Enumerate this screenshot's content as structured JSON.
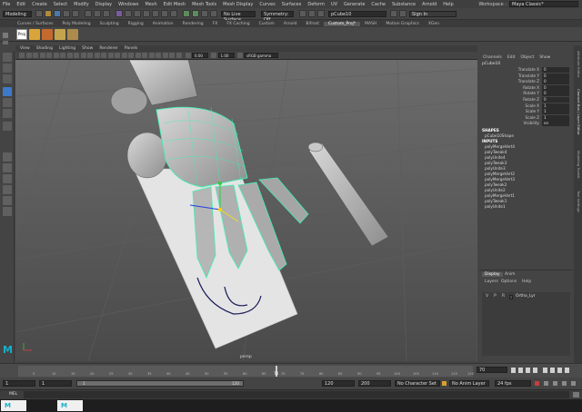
{
  "menubar": {
    "items": [
      "File",
      "Edit",
      "Create",
      "Select",
      "Modify",
      "Display",
      "Windows",
      "Mesh",
      "Edit Mesh",
      "Mesh Tools",
      "Mesh Display",
      "Curves",
      "Surfaces",
      "Deform",
      "UV",
      "Generate",
      "Cache",
      "Substance",
      "Arnold",
      "Help"
    ],
    "workspace_label": "Workspace :",
    "workspace_value": "Maya Classic*"
  },
  "statusline": {
    "mode": "Modeling",
    "live_surface": "No Live Surface",
    "symmetry": "Symmetry: Off",
    "object_name": "pCube10",
    "sign_in": "Sign In"
  },
  "shelf": {
    "tabs": [
      "Curves / Surfaces",
      "Poly Modeling",
      "Sculpting",
      "Rigging",
      "Animation",
      "Rendering",
      "FX",
      "FX Caching",
      "Custom",
      "Arnold",
      "Bifrost",
      "Custom_Proj*",
      "MASH",
      "Motion Graphics",
      "XGen"
    ],
    "active_tab": "Custom_Proj*",
    "label": "Proj"
  },
  "viewport": {
    "menus": [
      "View",
      "Shading",
      "Lighting",
      "Show",
      "Renderer",
      "Panels"
    ],
    "field1": "0.00",
    "field2": "1.00",
    "color_space": "sRGB gamma",
    "camera_label": "persp"
  },
  "channelbox": {
    "menus": [
      "Channels",
      "Edit",
      "Object",
      "Show"
    ],
    "object": "pCube10",
    "attributes": [
      {
        "name": "Translate X",
        "value": "0"
      },
      {
        "name": "Translate Y",
        "value": "0"
      },
      {
        "name": "Translate Z",
        "value": "0"
      },
      {
        "name": "Rotate X",
        "value": "0"
      },
      {
        "name": "Rotate Y",
        "value": "0"
      },
      {
        "name": "Rotate Z",
        "value": "0"
      },
      {
        "name": "Scale X",
        "value": "1"
      },
      {
        "name": "Scale Y",
        "value": "1"
      },
      {
        "name": "Scale Z",
        "value": "1"
      },
      {
        "name": "Visibility",
        "value": "on"
      }
    ],
    "shapes_header": "SHAPES",
    "shape": "pCube10Shape",
    "inputs_header": "INPUTS",
    "inputs": [
      "polyMergeVert4",
      "polyTweak4",
      "polyUnite4",
      "polyTweak3",
      "polyUnite3",
      "polyMergeVert2",
      "polyMergeVert3",
      "polyTweak2",
      "polyUnite2",
      "polyMergeVert1",
      "polyTweak1",
      "polyUnite1"
    ]
  },
  "layer_editor": {
    "tabs": [
      "Display",
      "Anim"
    ],
    "menus": [
      "Layers",
      "Options",
      "Help"
    ],
    "layer_flags": [
      "V",
      "P",
      "R"
    ],
    "layer_name": "Ortho_Lyr"
  },
  "right_tabs": [
    "Attribute Editor",
    "Channel Box / Layer Editor",
    "Modeling Toolkit",
    "Tool Settings"
  ],
  "timeline": {
    "ticks": [
      "5",
      "10",
      "15",
      "20",
      "25",
      "30",
      "35",
      "40",
      "45",
      "50",
      "55",
      "60",
      "65",
      "70",
      "75",
      "80",
      "85",
      "90",
      "95",
      "100",
      "105",
      "110",
      "115",
      "120"
    ],
    "current_frame": "70",
    "end_field": "70"
  },
  "range": {
    "start": "1",
    "start_inner": "1",
    "range_left": "1",
    "range_right": "120",
    "end_inner": "120",
    "end": "200",
    "character_set": "No Character Set",
    "anim_layer": "No Anim Layer",
    "fps": "24 fps"
  },
  "cmdline": {
    "label": "MEL"
  },
  "taskbar": {
    "items": [
      "M",
      "M"
    ]
  }
}
